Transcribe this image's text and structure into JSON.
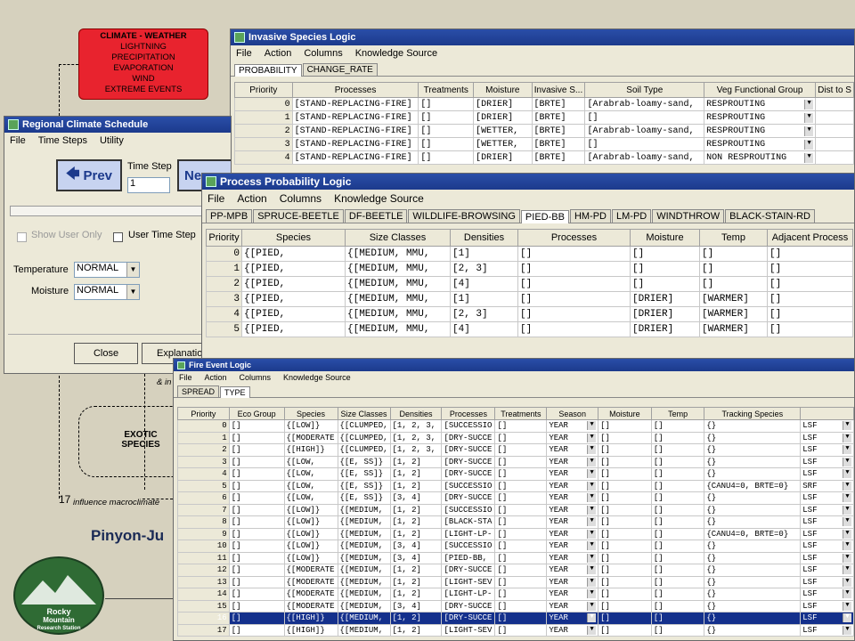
{
  "diagram": {
    "climate_box": {
      "title": "CLIMATE - WEATHER",
      "items": [
        "LIGHTNING",
        "PRECIPITATION",
        "EVAPORATION",
        "WIND",
        "EXTREME EVENTS"
      ]
    },
    "exotic_box": {
      "line1": "EXOTIC",
      "line2": "SPECIES"
    },
    "label_17": "17",
    "label_influence": "influence macroclimate",
    "label_amp": "& in",
    "title": "Pinyon-Ju"
  },
  "invasive": {
    "title": "Invasive Species Logic",
    "menu": [
      "File",
      "Action",
      "Columns",
      "Knowledge Source"
    ],
    "tabs": [
      "PROBABILITY",
      "CHANGE_RATE"
    ],
    "columns": [
      "Priority",
      "Processes",
      "Treatments",
      "Moisture",
      "Invasive S...",
      "Soil Type",
      "Veg Functional Group",
      "Dist to S"
    ],
    "rows": [
      [
        "0",
        "[STAND-REPLACING-FIRE]",
        "[]",
        "[DRIER]",
        "[BRTE]",
        "[Arabrab-loamy-sand,",
        "RESPROUTING",
        ""
      ],
      [
        "1",
        "[STAND-REPLACING-FIRE]",
        "[]",
        "[DRIER]",
        "[BRTE]",
        "[]",
        "RESPROUTING",
        ""
      ],
      [
        "2",
        "[STAND-REPLACING-FIRE]",
        "[]",
        "[WETTER,",
        "[BRTE]",
        "[Arabrab-loamy-sand,",
        "RESPROUTING",
        ""
      ],
      [
        "3",
        "[STAND-REPLACING-FIRE]",
        "[]",
        "[WETTER,",
        "[BRTE]",
        "[]",
        "RESPROUTING",
        ""
      ],
      [
        "4",
        "[STAND-REPLACING-FIRE]",
        "[]",
        "[DRIER]",
        "[BRTE]",
        "[Arabrab-loamy-sand,",
        "NON RESPROUTING",
        ""
      ]
    ]
  },
  "climate": {
    "title": "Regional Climate Schedule",
    "menu": [
      "File",
      "Time Steps",
      "Utility"
    ],
    "prev_label": "Prev",
    "next_label": "Ne",
    "time_step_label": "Time Step",
    "time_step_value": "1",
    "show_user_only": "Show User Only",
    "user_time_step": "User Time Step",
    "temperature_label": "Temperature",
    "temperature_value": "NORMAL",
    "moisture_label": "Moisture",
    "moisture_value": "NORMAL",
    "close_label": "Close",
    "explanation_label": "Explanatio"
  },
  "process": {
    "title": "Process Probability Logic",
    "menu": [
      "File",
      "Action",
      "Columns",
      "Knowledge Source"
    ],
    "tabs": [
      "PP-MPB",
      "SPRUCE-BEETLE",
      "DF-BEETLE",
      "WILDLIFE-BROWSING",
      "PIED-BB",
      "HM-PD",
      "LM-PD",
      "WINDTHROW",
      "BLACK-STAIN-RD"
    ],
    "selected_tab": "PIED-BB",
    "columns": [
      "Priority",
      "Species",
      "Size Classes",
      "Densities",
      "Processes",
      "Moisture",
      "Temp",
      "Adjacent Process"
    ],
    "rows": [
      [
        "0",
        "{[PIED,",
        "{[MEDIUM, MMU,",
        "[1]",
        "[]",
        "[]",
        "[]",
        "[]"
      ],
      [
        "1",
        "{[PIED,",
        "{[MEDIUM, MMU,",
        "[2, 3]",
        "[]",
        "[]",
        "[]",
        "[]"
      ],
      [
        "2",
        "{[PIED,",
        "{[MEDIUM, MMU,",
        "[4]",
        "[]",
        "[]",
        "[]",
        "[]"
      ],
      [
        "3",
        "{[PIED,",
        "{[MEDIUM, MMU,",
        "[1]",
        "[]",
        "[DRIER]",
        "[WARMER]",
        "[]"
      ],
      [
        "4",
        "{[PIED,",
        "{[MEDIUM, MMU,",
        "[2, 3]",
        "[]",
        "[DRIER]",
        "[WARMER]",
        "[]"
      ],
      [
        "5",
        "{[PIED,",
        "{[MEDIUM, MMU,",
        "[4]",
        "[]",
        "[DRIER]",
        "[WARMER]",
        "[]"
      ]
    ]
  },
  "fire": {
    "title": "Fire Event Logic",
    "menu": [
      "File",
      "Action",
      "Columns",
      "Knowledge Source"
    ],
    "tabs": [
      "SPREAD",
      "TYPE"
    ],
    "columns": [
      "Priority",
      "Eco Group",
      "Species",
      "Size Classes",
      "Densities",
      "Processes",
      "Treatments",
      "Season",
      "Moisture",
      "Temp",
      "Tracking Species",
      ""
    ],
    "rows": [
      [
        "0",
        "[]",
        "{[LOW]}",
        "{[CLUMPED,",
        "[1, 2, 3,",
        "[SUCCESSIO",
        "[]",
        "YEAR",
        "[]",
        "[]",
        "{}",
        "LSF"
      ],
      [
        "1",
        "[]",
        "{[MODERATE",
        "{[CLUMPED,",
        "[1, 2, 3,",
        "[DRY-SUCCE",
        "[]",
        "YEAR",
        "[]",
        "[]",
        "{}",
        "LSF"
      ],
      [
        "2",
        "[]",
        "{[HIGH]}",
        "{[CLUMPED,",
        "[1, 2, 3,",
        "[DRY-SUCCE",
        "[]",
        "YEAR",
        "[]",
        "[]",
        "{}",
        "LSF"
      ],
      [
        "3",
        "[]",
        "{[LOW,",
        "{[E, SS]}",
        "[1, 2]",
        "[DRY-SUCCE",
        "[]",
        "YEAR",
        "[]",
        "[]",
        "{}",
        "LSF"
      ],
      [
        "4",
        "[]",
        "{[LOW,",
        "{[E, SS]}",
        "[1, 2]",
        "[DRY-SUCCE",
        "[]",
        "YEAR",
        "[]",
        "[]",
        "{}",
        "LSF"
      ],
      [
        "5",
        "[]",
        "{[LOW,",
        "{[E, SS]}",
        "[1, 2]",
        "[SUCCESSIO",
        "[]",
        "YEAR",
        "[]",
        "[]",
        "{CANU4=0, BRTE=0}",
        "SRF"
      ],
      [
        "6",
        "[]",
        "{[LOW,",
        "{[E, SS]}",
        "[3, 4]",
        "[DRY-SUCCE",
        "[]",
        "YEAR",
        "[]",
        "[]",
        "{}",
        "LSF"
      ],
      [
        "7",
        "[]",
        "{[LOW]}",
        "{[MEDIUM,",
        "[1, 2]",
        "[SUCCESSIO",
        "[]",
        "YEAR",
        "[]",
        "[]",
        "{}",
        "LSF"
      ],
      [
        "8",
        "[]",
        "{[LOW]}",
        "{[MEDIUM,",
        "[1, 2]",
        "[BLACK-STA",
        "[]",
        "YEAR",
        "[]",
        "[]",
        "{}",
        "LSF"
      ],
      [
        "9",
        "[]",
        "{[LOW]}",
        "{[MEDIUM,",
        "[1, 2]",
        "[LIGHT-LP-",
        "[]",
        "YEAR",
        "[]",
        "[]",
        "{CANU4=0, BRTE=0}",
        "LSF"
      ],
      [
        "10",
        "[]",
        "{[LOW]}",
        "{[MEDIUM,",
        "[3, 4]",
        "[SUCCESSIO",
        "[]",
        "YEAR",
        "[]",
        "[]",
        "{}",
        "LSF"
      ],
      [
        "11",
        "[]",
        "{[LOW]}",
        "{[MEDIUM,",
        "[3, 4]",
        "[PIED-BB,",
        "[]",
        "YEAR",
        "[]",
        "[]",
        "{}",
        "LSF"
      ],
      [
        "12",
        "[]",
        "{[MODERATE",
        "{[MEDIUM,",
        "[1, 2]",
        "[DRY-SUCCE",
        "[]",
        "YEAR",
        "[]",
        "[]",
        "{}",
        "LSF"
      ],
      [
        "13",
        "[]",
        "{[MODERATE",
        "{[MEDIUM,",
        "[1, 2]",
        "[LIGHT-SEV",
        "[]",
        "YEAR",
        "[]",
        "[]",
        "{}",
        "LSF"
      ],
      [
        "14",
        "[]",
        "{[MODERATE",
        "{[MEDIUM,",
        "[1, 2]",
        "[LIGHT-LP-",
        "[]",
        "YEAR",
        "[]",
        "[]",
        "{}",
        "LSF"
      ],
      [
        "15",
        "[]",
        "{[MODERATE",
        "{[MEDIUM,",
        "[3, 4]",
        "[DRY-SUCCE",
        "[]",
        "YEAR",
        "[]",
        "[]",
        "{}",
        "LSF"
      ],
      [
        "16",
        "[]",
        "{[HIGH]}",
        "{[MEDIUM,",
        "[1, 2]",
        "[DRY-SUCCE",
        "[]",
        "YEAR",
        "[]",
        "[]",
        "{}",
        "LSF"
      ],
      [
        "17",
        "[]",
        "{[HIGH]}",
        "{[MEDIUM,",
        "[1, 2]",
        "[LIGHT-SEV",
        "[]",
        "YEAR",
        "[]",
        "[]",
        "{}",
        "LSF"
      ]
    ],
    "selected_row": 16
  }
}
